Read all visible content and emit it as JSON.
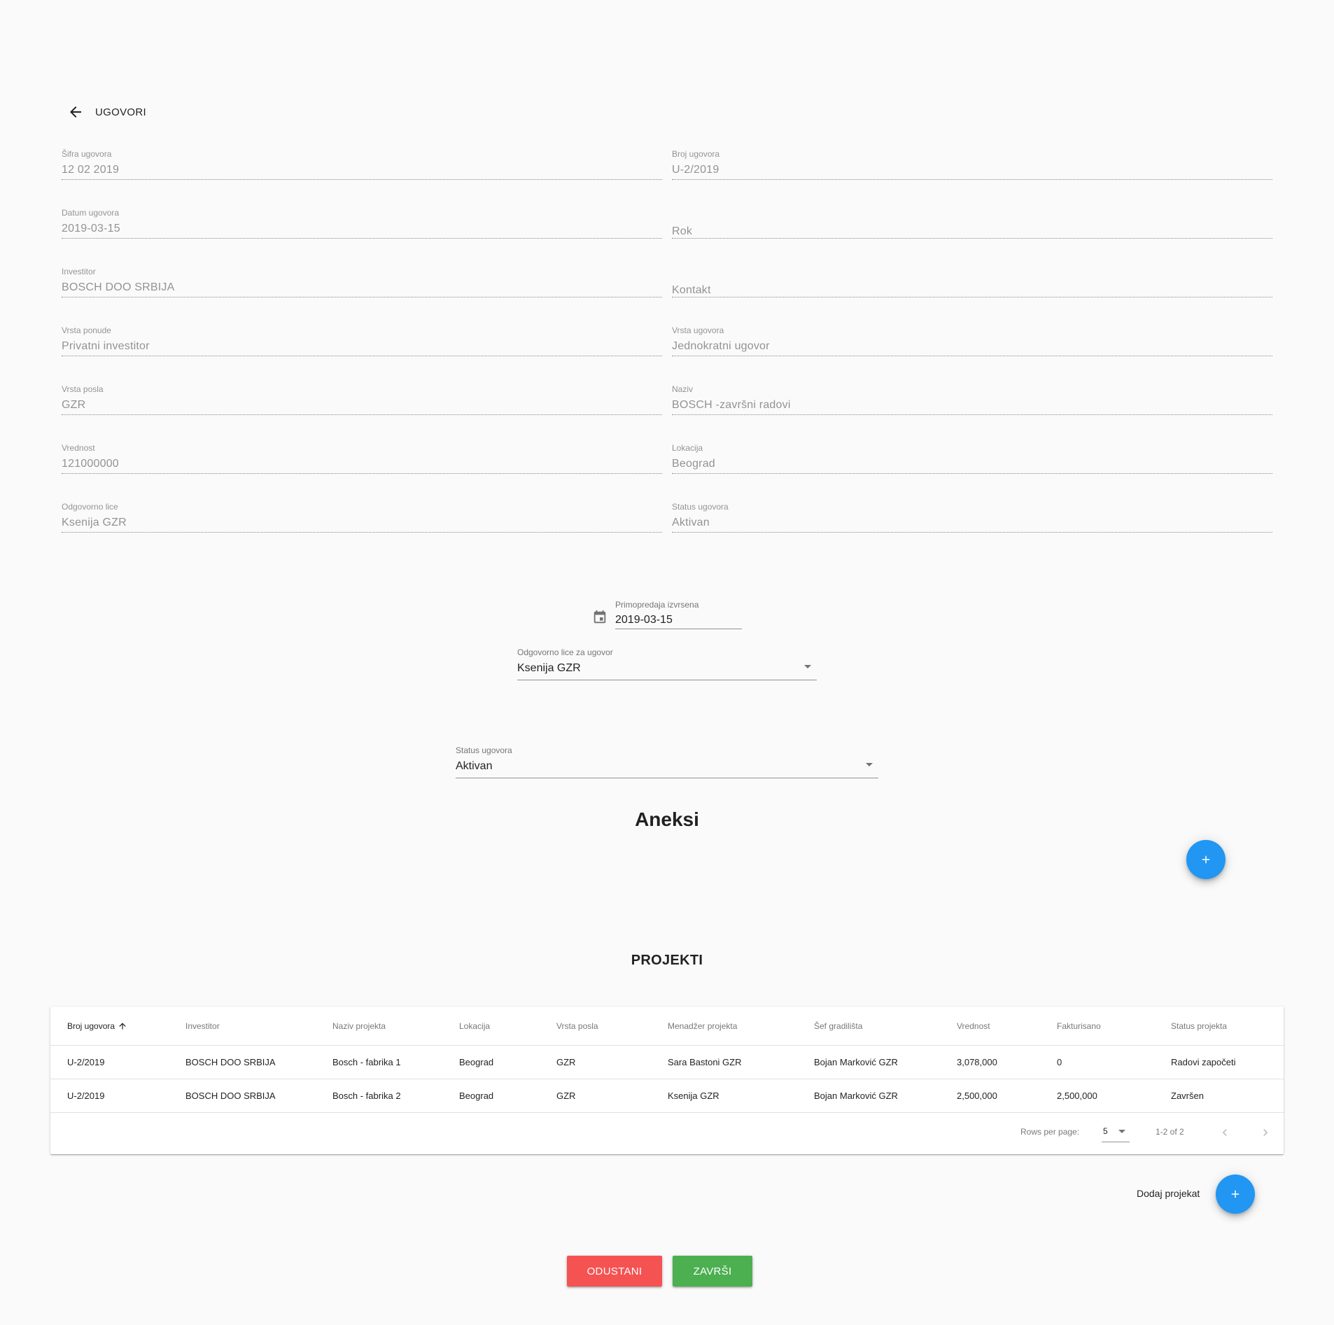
{
  "header": {
    "back_label": "UGOVORI"
  },
  "fields": [
    {
      "label": "Šifra ugovora",
      "value": "12 02 2019"
    },
    {
      "label": "Broj ugovora",
      "value": "U-2/2019"
    },
    {
      "label": "Datum ugovora",
      "value": "2019-03-15"
    },
    {
      "label": "",
      "value": "Rok"
    },
    {
      "label": "Investitor",
      "value": "BOSCH DOO SRBIJA"
    },
    {
      "label": "",
      "value": "Kontakt"
    },
    {
      "label": "Vrsta ponude",
      "value": "Privatni investitor"
    },
    {
      "label": "Vrsta ugovora",
      "value": "Jednokratni ugovor"
    },
    {
      "label": "Vrsta posla",
      "value": "GZR"
    },
    {
      "label": "Naziv",
      "value": "BOSCH -završni radovi"
    },
    {
      "label": "Vrednost",
      "value": "121000000"
    },
    {
      "label": "Lokacija",
      "value": "Beograd"
    },
    {
      "label": "Odgovorno lice",
      "value": "Ksenija GZR"
    },
    {
      "label": "Status ugovora",
      "value": "Aktivan"
    }
  ],
  "primopredaja": {
    "label": "Primopredaja izvrsena",
    "value": "2019-03-15"
  },
  "odgovorno_select": {
    "label": "Odgovorno lice za ugovor",
    "value": "Ksenija GZR"
  },
  "status_select": {
    "label": "Status ugovora",
    "value": "Aktivan"
  },
  "aneksi": {
    "title": "Aneksi"
  },
  "projekti": {
    "title": "PROJEKTI",
    "columns": [
      "Broj ugovora",
      "Investitor",
      "Naziv projekta",
      "Lokacija",
      "Vrsta posla",
      "Menadžer projekta",
      "Šef gradilišta",
      "Vrednost",
      "Fakturisano",
      "Status projekta"
    ],
    "rows": [
      [
        "U-2/2019",
        "BOSCH DOO SRBIJA",
        "Bosch - fabrika 1",
        "Beograd",
        "GZR",
        "Sara Bastoni GZR",
        "Bojan Marković GZR",
        "3,078,000",
        "0",
        "Radovi započeti"
      ],
      [
        "U-2/2019",
        "BOSCH DOO SRBIJA",
        "Bosch - fabrika 2",
        "Beograd",
        "GZR",
        "Ksenija GZR",
        "Bojan Marković GZR",
        "2,500,000",
        "2,500,000",
        "Završen"
      ]
    ],
    "pagination": {
      "rows_per_page_label": "Rows per page:",
      "rows_per_page": "5",
      "range": "1-2 of 2"
    },
    "add_label": "Dodaj projekat"
  },
  "actions": {
    "cancel": "ODUSTANI",
    "finish": "ZAVRŠI"
  },
  "colors": {
    "fab": "#2196f3",
    "cancel": "#f55252",
    "finish": "#4caf50",
    "background": "#fafafa"
  }
}
